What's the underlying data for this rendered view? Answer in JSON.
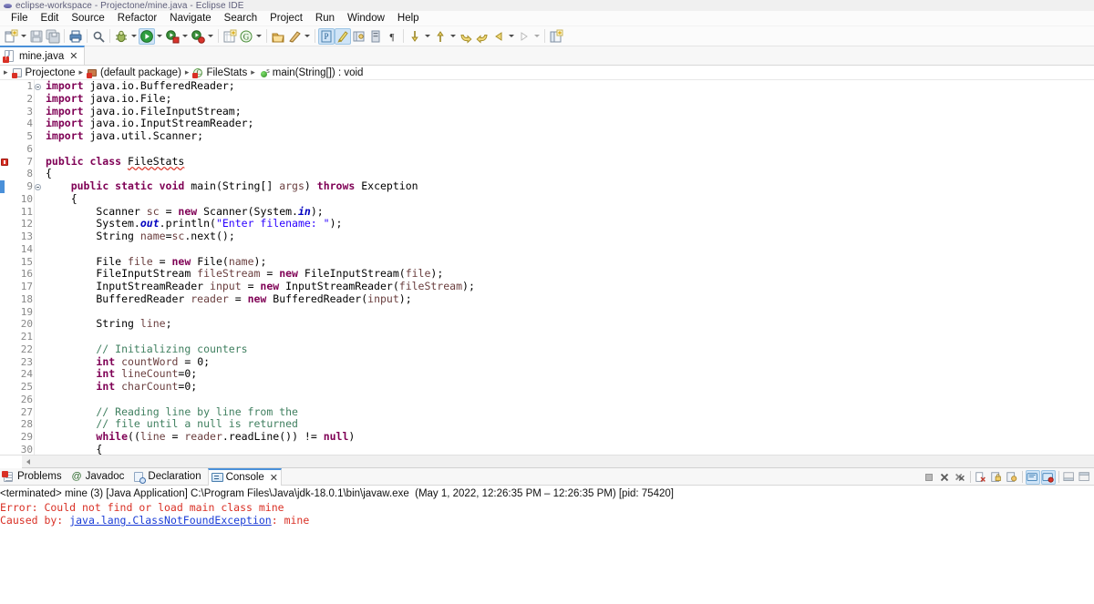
{
  "window": {
    "title": "eclipse-workspace - Projectone/mine.java - Eclipse IDE"
  },
  "menubar": {
    "items": [
      {
        "label": "File"
      },
      {
        "label": "Edit"
      },
      {
        "label": "Source"
      },
      {
        "label": "Refactor"
      },
      {
        "label": "Navigate"
      },
      {
        "label": "Search"
      },
      {
        "label": "Project"
      },
      {
        "label": "Run"
      },
      {
        "label": "Window"
      },
      {
        "label": "Help"
      }
    ]
  },
  "toolbar": {
    "icons": [
      {
        "name": "new-wizard-icon"
      },
      {
        "name": "new-wizard-dropdown-icon"
      },
      {
        "name": "save-icon"
      },
      {
        "name": "save-all-icon"
      },
      {
        "name": "print-icon"
      },
      {
        "name": "search-icon"
      },
      {
        "name": "debug-icon"
      },
      {
        "name": "debug-dropdown-icon"
      },
      {
        "name": "run-icon"
      },
      {
        "name": "run-dropdown-icon"
      },
      {
        "name": "run-external-tools-icon"
      },
      {
        "name": "external-tools-dropdown-icon"
      },
      {
        "name": "coverage-icon"
      },
      {
        "name": "coverage-dropdown-icon"
      },
      {
        "name": "new-java-project-icon"
      },
      {
        "name": "new-package-icon"
      },
      {
        "name": "new-class-dropdown-icon"
      },
      {
        "name": "open-type-icon"
      },
      {
        "name": "toggle-mark-occurrences-icon"
      },
      {
        "name": "mark-occurrences-dropdown-icon"
      },
      {
        "name": "skip-all-breakpoints-icon"
      },
      {
        "name": "link-with-editor-icon"
      },
      {
        "name": "pin-editor-icon"
      },
      {
        "name": "show-whitespace-icon"
      },
      {
        "name": "paragraph-icon"
      },
      {
        "name": "next-annotation-icon"
      },
      {
        "name": "next-annotation-dropdown-icon"
      },
      {
        "name": "previous-annotation-icon"
      },
      {
        "name": "previous-annotation-dropdown-icon"
      },
      {
        "name": "back-icon"
      },
      {
        "name": "forward-icon"
      },
      {
        "name": "previous-edit-icon"
      },
      {
        "name": "previous-edit-dropdown-icon"
      },
      {
        "name": "next-edit-icon"
      },
      {
        "name": "next-edit-dropdown-icon"
      },
      {
        "name": "open-perspective-icon"
      }
    ]
  },
  "editor": {
    "tab": {
      "label": "mine.java",
      "close": "✕",
      "has_error": true
    },
    "breadcrumb": [
      {
        "label": "Projectone",
        "icon": "project-icon"
      },
      {
        "label": "(default package)",
        "icon": "package-icon"
      },
      {
        "label": "FileStats",
        "icon": "class-icon"
      },
      {
        "label": "main(String[]) : void",
        "icon": "method-icon"
      }
    ],
    "breadcrumb_separator": "▸",
    "lines": [
      {
        "num": "1",
        "fold": true,
        "marker": "",
        "tokens": [
          {
            "t": "import",
            "c": "kw"
          },
          {
            "t": " java.io.BufferedReader;",
            "c": "plain"
          }
        ]
      },
      {
        "num": "2",
        "fold": false,
        "marker": "",
        "tokens": [
          {
            "t": "import",
            "c": "kw"
          },
          {
            "t": " java.io.File;",
            "c": "plain"
          }
        ]
      },
      {
        "num": "3",
        "fold": false,
        "marker": "",
        "tokens": [
          {
            "t": "import",
            "c": "kw"
          },
          {
            "t": " java.io.FileInputStream;",
            "c": "plain"
          }
        ]
      },
      {
        "num": "4",
        "fold": false,
        "marker": "",
        "tokens": [
          {
            "t": "import",
            "c": "kw"
          },
          {
            "t": " java.io.InputStreamReader;",
            "c": "plain"
          }
        ]
      },
      {
        "num": "5",
        "fold": false,
        "marker": "",
        "tokens": [
          {
            "t": "import",
            "c": "kw"
          },
          {
            "t": " java.util.Scanner;",
            "c": "plain"
          }
        ]
      },
      {
        "num": "6",
        "fold": false,
        "marker": "",
        "tokens": []
      },
      {
        "num": "7",
        "fold": false,
        "marker": "error",
        "tokens": [
          {
            "t": "public class ",
            "c": "kw"
          },
          {
            "t": "FileStats",
            "c": "plain err"
          }
        ]
      },
      {
        "num": "8",
        "fold": false,
        "marker": "",
        "tokens": [
          {
            "t": "{",
            "c": "plain"
          }
        ]
      },
      {
        "num": "9",
        "fold": true,
        "marker": "current",
        "tokens": [
          {
            "t": "    ",
            "c": "plain"
          },
          {
            "t": "public static void ",
            "c": "kw"
          },
          {
            "t": "main(String[] ",
            "c": "plain"
          },
          {
            "t": "args",
            "c": "loc"
          },
          {
            "t": ") ",
            "c": "plain"
          },
          {
            "t": "throws",
            "c": "kw"
          },
          {
            "t": " Exception",
            "c": "plain"
          }
        ]
      },
      {
        "num": "10",
        "fold": false,
        "marker": "",
        "tokens": [
          {
            "t": "    {",
            "c": "plain"
          }
        ]
      },
      {
        "num": "11",
        "fold": false,
        "marker": "",
        "tokens": [
          {
            "t": "        Scanner ",
            "c": "plain"
          },
          {
            "t": "sc",
            "c": "loc"
          },
          {
            "t": " = ",
            "c": "plain"
          },
          {
            "t": "new",
            "c": "kw"
          },
          {
            "t": " Scanner(System.",
            "c": "plain"
          },
          {
            "t": "in",
            "c": "fld"
          },
          {
            "t": ");",
            "c": "plain"
          }
        ]
      },
      {
        "num": "12",
        "fold": false,
        "marker": "",
        "tokens": [
          {
            "t": "        System.",
            "c": "plain"
          },
          {
            "t": "out",
            "c": "fld"
          },
          {
            "t": ".println(",
            "c": "plain"
          },
          {
            "t": "\"Enter filename: \"",
            "c": "str"
          },
          {
            "t": ");",
            "c": "plain"
          }
        ]
      },
      {
        "num": "13",
        "fold": false,
        "marker": "",
        "tokens": [
          {
            "t": "        String ",
            "c": "plain"
          },
          {
            "t": "name",
            "c": "loc"
          },
          {
            "t": "=",
            "c": "plain"
          },
          {
            "t": "sc",
            "c": "loc"
          },
          {
            "t": ".next();",
            "c": "plain"
          }
        ]
      },
      {
        "num": "14",
        "fold": false,
        "marker": "",
        "tokens": []
      },
      {
        "num": "15",
        "fold": false,
        "marker": "",
        "tokens": [
          {
            "t": "        File ",
            "c": "plain"
          },
          {
            "t": "file",
            "c": "loc"
          },
          {
            "t": " = ",
            "c": "plain"
          },
          {
            "t": "new",
            "c": "kw"
          },
          {
            "t": " File(",
            "c": "plain"
          },
          {
            "t": "name",
            "c": "loc"
          },
          {
            "t": ");",
            "c": "plain"
          }
        ]
      },
      {
        "num": "16",
        "fold": false,
        "marker": "",
        "tokens": [
          {
            "t": "        FileInputStream ",
            "c": "plain"
          },
          {
            "t": "fileStream",
            "c": "loc"
          },
          {
            "t": " = ",
            "c": "plain"
          },
          {
            "t": "new",
            "c": "kw"
          },
          {
            "t": " FileInputStream(",
            "c": "plain"
          },
          {
            "t": "file",
            "c": "loc"
          },
          {
            "t": ");",
            "c": "plain"
          }
        ]
      },
      {
        "num": "17",
        "fold": false,
        "marker": "",
        "tokens": [
          {
            "t": "        InputStreamReader ",
            "c": "plain"
          },
          {
            "t": "input",
            "c": "loc"
          },
          {
            "t": " = ",
            "c": "plain"
          },
          {
            "t": "new",
            "c": "kw"
          },
          {
            "t": " InputStreamReader(",
            "c": "plain"
          },
          {
            "t": "fileStream",
            "c": "loc"
          },
          {
            "t": ");",
            "c": "plain"
          }
        ]
      },
      {
        "num": "18",
        "fold": false,
        "marker": "",
        "tokens": [
          {
            "t": "        BufferedReader ",
            "c": "plain"
          },
          {
            "t": "reader",
            "c": "loc"
          },
          {
            "t": " = ",
            "c": "plain"
          },
          {
            "t": "new",
            "c": "kw"
          },
          {
            "t": " BufferedReader(",
            "c": "plain"
          },
          {
            "t": "input",
            "c": "loc"
          },
          {
            "t": ");",
            "c": "plain"
          }
        ]
      },
      {
        "num": "19",
        "fold": false,
        "marker": "",
        "tokens": []
      },
      {
        "num": "20",
        "fold": false,
        "marker": "",
        "tokens": [
          {
            "t": "        String ",
            "c": "plain"
          },
          {
            "t": "line",
            "c": "loc"
          },
          {
            "t": ";",
            "c": "plain"
          }
        ]
      },
      {
        "num": "21",
        "fold": false,
        "marker": "",
        "tokens": []
      },
      {
        "num": "22",
        "fold": false,
        "marker": "",
        "tokens": [
          {
            "t": "        // Initializing counters",
            "c": "cmt"
          }
        ]
      },
      {
        "num": "23",
        "fold": false,
        "marker": "",
        "tokens": [
          {
            "t": "        ",
            "c": "plain"
          },
          {
            "t": "int",
            "c": "kw"
          },
          {
            "t": " ",
            "c": "plain"
          },
          {
            "t": "countWord",
            "c": "loc"
          },
          {
            "t": " = 0;",
            "c": "plain"
          }
        ]
      },
      {
        "num": "24",
        "fold": false,
        "marker": "",
        "tokens": [
          {
            "t": "        ",
            "c": "plain"
          },
          {
            "t": "int",
            "c": "kw"
          },
          {
            "t": " ",
            "c": "plain"
          },
          {
            "t": "lineCount",
            "c": "loc"
          },
          {
            "t": "=0;",
            "c": "plain"
          }
        ]
      },
      {
        "num": "25",
        "fold": false,
        "marker": "",
        "tokens": [
          {
            "t": "        ",
            "c": "plain"
          },
          {
            "t": "int",
            "c": "kw"
          },
          {
            "t": " ",
            "c": "plain"
          },
          {
            "t": "charCount",
            "c": "loc"
          },
          {
            "t": "=0;",
            "c": "plain"
          }
        ]
      },
      {
        "num": "26",
        "fold": false,
        "marker": "",
        "tokens": []
      },
      {
        "num": "27",
        "fold": false,
        "marker": "",
        "tokens": [
          {
            "t": "        // Reading line by line from the",
            "c": "cmt"
          }
        ]
      },
      {
        "num": "28",
        "fold": false,
        "marker": "",
        "tokens": [
          {
            "t": "        // file until a null is returned",
            "c": "cmt"
          }
        ]
      },
      {
        "num": "29",
        "fold": false,
        "marker": "",
        "tokens": [
          {
            "t": "        ",
            "c": "plain"
          },
          {
            "t": "while",
            "c": "kw"
          },
          {
            "t": "((",
            "c": "plain"
          },
          {
            "t": "line",
            "c": "loc"
          },
          {
            "t": " = ",
            "c": "plain"
          },
          {
            "t": "reader",
            "c": "loc"
          },
          {
            "t": ".readLine()) != ",
            "c": "plain"
          },
          {
            "t": "null",
            "c": "kw"
          },
          {
            "t": ")",
            "c": "plain"
          }
        ]
      },
      {
        "num": "30",
        "fold": false,
        "marker": "",
        "tokens": [
          {
            "t": "        {",
            "c": "plain"
          }
        ]
      }
    ]
  },
  "bottom_panel": {
    "tabs": [
      {
        "label": "Problems",
        "icon": "problems-icon",
        "selected": false,
        "closable": false
      },
      {
        "label": "Javadoc",
        "icon": "javadoc-icon",
        "selected": false,
        "closable": false
      },
      {
        "label": "Declaration",
        "icon": "declaration-icon",
        "selected": false,
        "closable": false
      },
      {
        "label": "Console",
        "icon": "console-icon",
        "selected": true,
        "closable": true,
        "close": "✕"
      }
    ],
    "toolbar_icons": [
      {
        "name": "terminate-icon"
      },
      {
        "name": "remove-launch-icon"
      },
      {
        "name": "remove-all-terminated-launches-icon"
      },
      {
        "name": "clear-console-icon"
      },
      {
        "name": "scroll-lock-icon"
      },
      {
        "name": "pin-console-icon"
      },
      {
        "name": "display-selected-console-icon"
      },
      {
        "name": "open-console-icon"
      },
      {
        "name": "minimize-icon"
      },
      {
        "name": "maximize-icon"
      }
    ],
    "console": {
      "header": "<terminated> mine (3) [Java Application] C:\\Program Files\\Java\\jdk-18.0.1\\bin\\javaw.exe  (May 1, 2022, 12:26:35 PM – 12:26:35 PM) [pid: 75420]",
      "lines": [
        {
          "segments": [
            {
              "text": "Error: Could not find or load main class mine",
              "style": "error"
            }
          ]
        },
        {
          "segments": [
            {
              "text": "Caused by: ",
              "style": "error"
            },
            {
              "text": "java.lang.ClassNotFoundException",
              "style": "link"
            },
            {
              "text": ": mine",
              "style": "error"
            }
          ]
        }
      ]
    }
  },
  "colors": {
    "accent": "#4a90d9",
    "error": "#d93025",
    "keyword": "#7f0055",
    "string": "#2a00ff",
    "comment": "#3f7f5f",
    "field": "#0000c0",
    "local": "#6a3e3e",
    "link": "#1a3cd6"
  }
}
